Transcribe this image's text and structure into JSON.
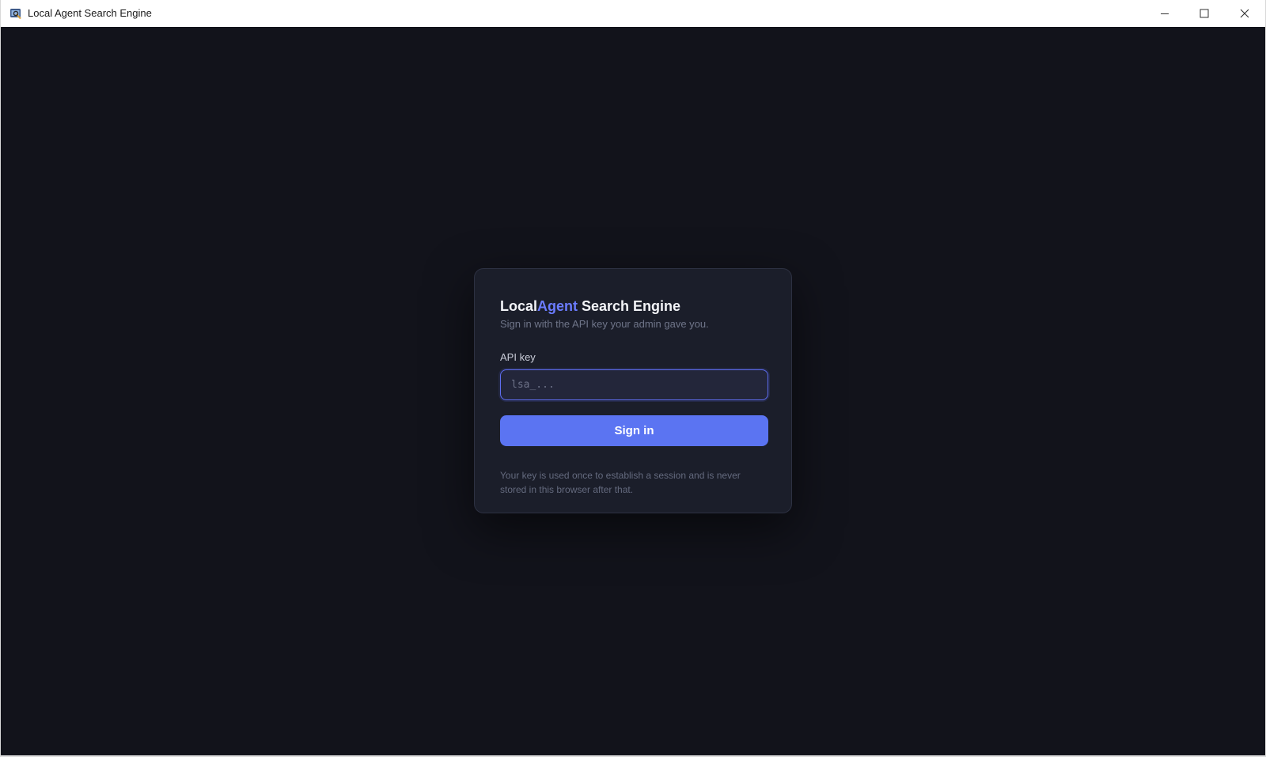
{
  "window": {
    "title": "Local Agent Search Engine",
    "controls": {
      "minimize": "minimize-icon",
      "maximize": "maximize-icon",
      "close": "close-icon"
    }
  },
  "login": {
    "brand_prefix": "Local",
    "brand_accent": "Agent",
    "brand_suffix": " Search Engine",
    "subtitle": "Sign in with the API key your admin gave you.",
    "api_key_label": "API key",
    "api_key_placeholder": "lsa_...",
    "api_key_value": "",
    "sign_in_label": "Sign in",
    "footnote": "Your key is used once to establish a session and is never stored in this browser after that."
  },
  "colors": {
    "background": "#12131b",
    "card": "#1b1e2a",
    "accent": "#6b7cff",
    "button": "#5b74f2"
  }
}
